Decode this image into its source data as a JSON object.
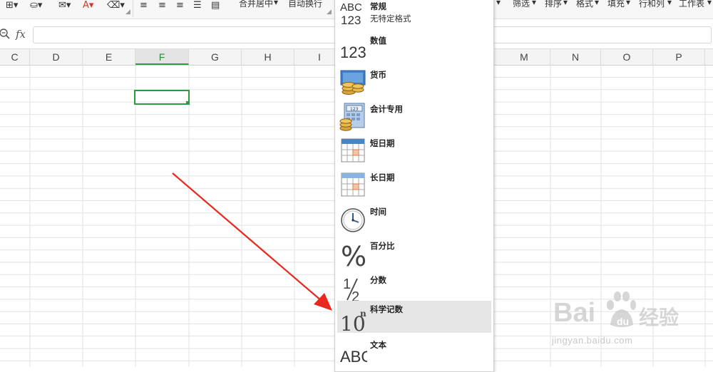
{
  "toolbar": {
    "merge_center": "合并居中",
    "wrap_text": "自动换行",
    "filter": "筛选",
    "sort": "排序",
    "format": "格式",
    "fill": "填充",
    "rows_cols": "行和列",
    "worksheet": "工作表"
  },
  "formula_bar": {
    "fx_label": "fx",
    "value": ""
  },
  "columns": [
    "C",
    "D",
    "E",
    "F",
    "G",
    "H",
    "I",
    "M",
    "N",
    "O",
    "P"
  ],
  "selected_column": "F",
  "format_menu": {
    "items": [
      {
        "icon": "abc-123-icon",
        "label": "常规",
        "sublabel": "无特定格式"
      },
      {
        "icon": "number-123-icon",
        "label": "数值"
      },
      {
        "icon": "currency-coins-icon",
        "label": "货币"
      },
      {
        "icon": "accounting-calculator-icon",
        "label": "会计专用"
      },
      {
        "icon": "short-date-calendar-icon",
        "label": "短日期"
      },
      {
        "icon": "long-date-calendar-icon",
        "label": "长日期"
      },
      {
        "icon": "clock-icon",
        "label": "时间"
      },
      {
        "icon": "percent-icon",
        "label": "百分比"
      },
      {
        "icon": "fraction-icon",
        "label": "分数"
      },
      {
        "icon": "scientific-notation-icon",
        "label": "科学记数",
        "highlighted": true
      },
      {
        "icon": "text-abc-icon",
        "label": "文本"
      }
    ]
  },
  "watermark": {
    "brand": "Bai",
    "brand_cn": "经验",
    "url": "jingyan.baidu.com"
  },
  "colors": {
    "accent_green": "#2a9d41",
    "arrow_red": "#e8291f",
    "highlight_bg": "#e6e6e6"
  }
}
